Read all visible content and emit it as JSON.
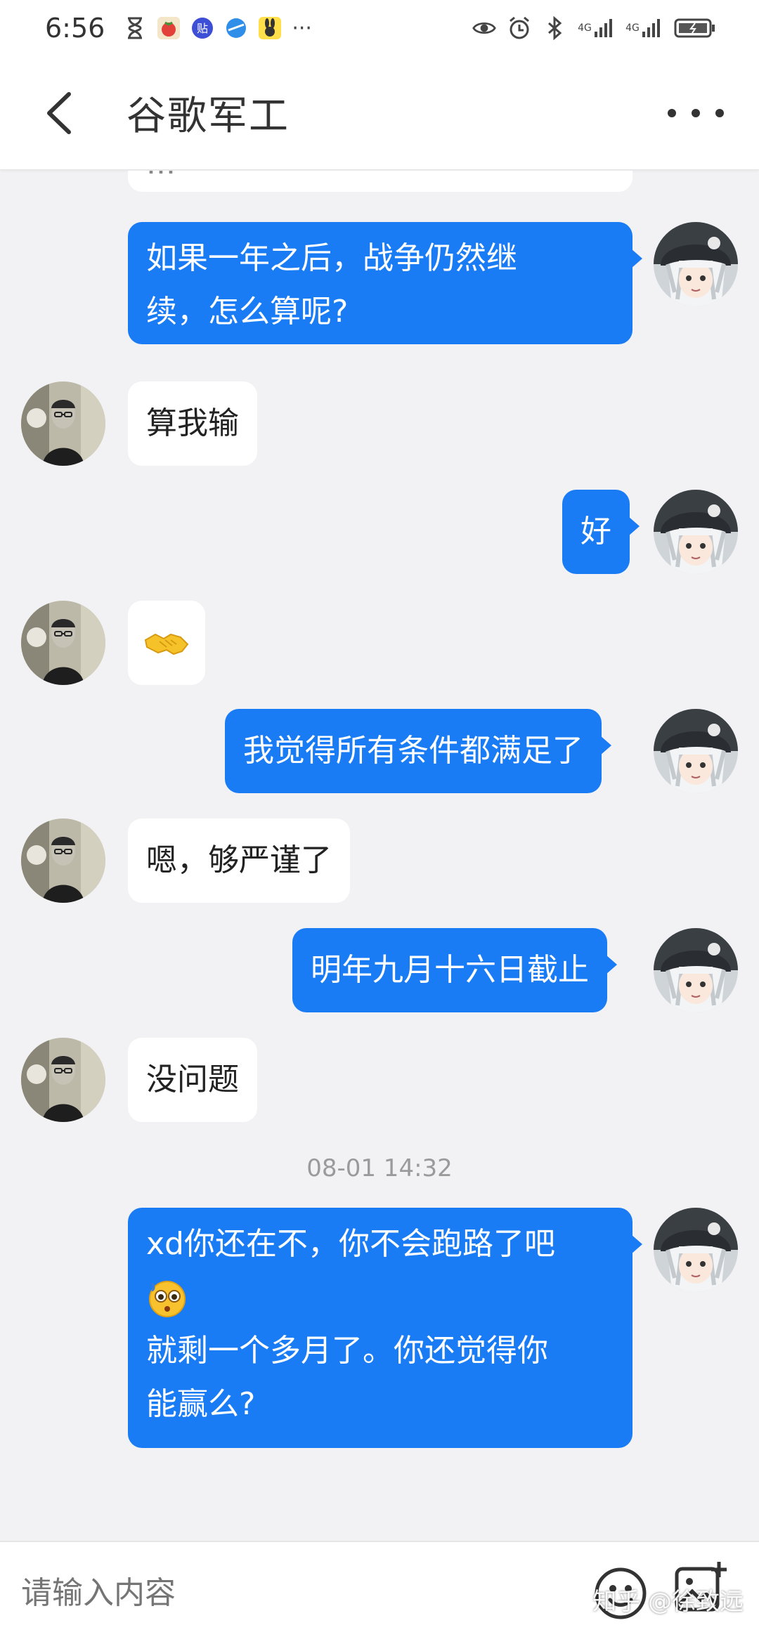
{
  "status_bar": {
    "time": "6:56",
    "network_1": "4G",
    "network_2": "4G",
    "more_indicator": "···"
  },
  "header": {
    "title": "谷歌军工"
  },
  "messages": [
    {
      "id": "m0",
      "side": "in",
      "text": "...",
      "partial": true
    },
    {
      "id": "m1",
      "side": "out",
      "lines": [
        "如果一年之后，战争仍然继",
        "续，怎么算呢?"
      ]
    },
    {
      "id": "m2",
      "side": "in",
      "text": "算我输"
    },
    {
      "id": "m3",
      "side": "out",
      "text": "好"
    },
    {
      "id": "m4",
      "side": "in",
      "emoji": "handshake-emoji"
    },
    {
      "id": "m5",
      "side": "out",
      "text": "我觉得所有条件都满足了"
    },
    {
      "id": "m6",
      "side": "in",
      "text": "嗯，够严谨了"
    },
    {
      "id": "m7",
      "side": "out",
      "text": "明年九月十六日截止"
    },
    {
      "id": "m8",
      "side": "in",
      "text": "没问题"
    },
    {
      "id": "m9",
      "side": "out",
      "lines": [
        "xd你还在不，你不会跑路了吧",
        "就剩一个多月了。你还觉得你",
        "能赢么?"
      ],
      "emoji": "surprised-face-emoji"
    }
  ],
  "timestamp": "08-01 14:32",
  "input": {
    "placeholder": "请输入内容"
  },
  "watermark": "知乎 @徐致远",
  "colors": {
    "outgoing_bubble": "#1a7cf5",
    "incoming_bubble": "#ffffff",
    "background": "#f2f2f4"
  }
}
